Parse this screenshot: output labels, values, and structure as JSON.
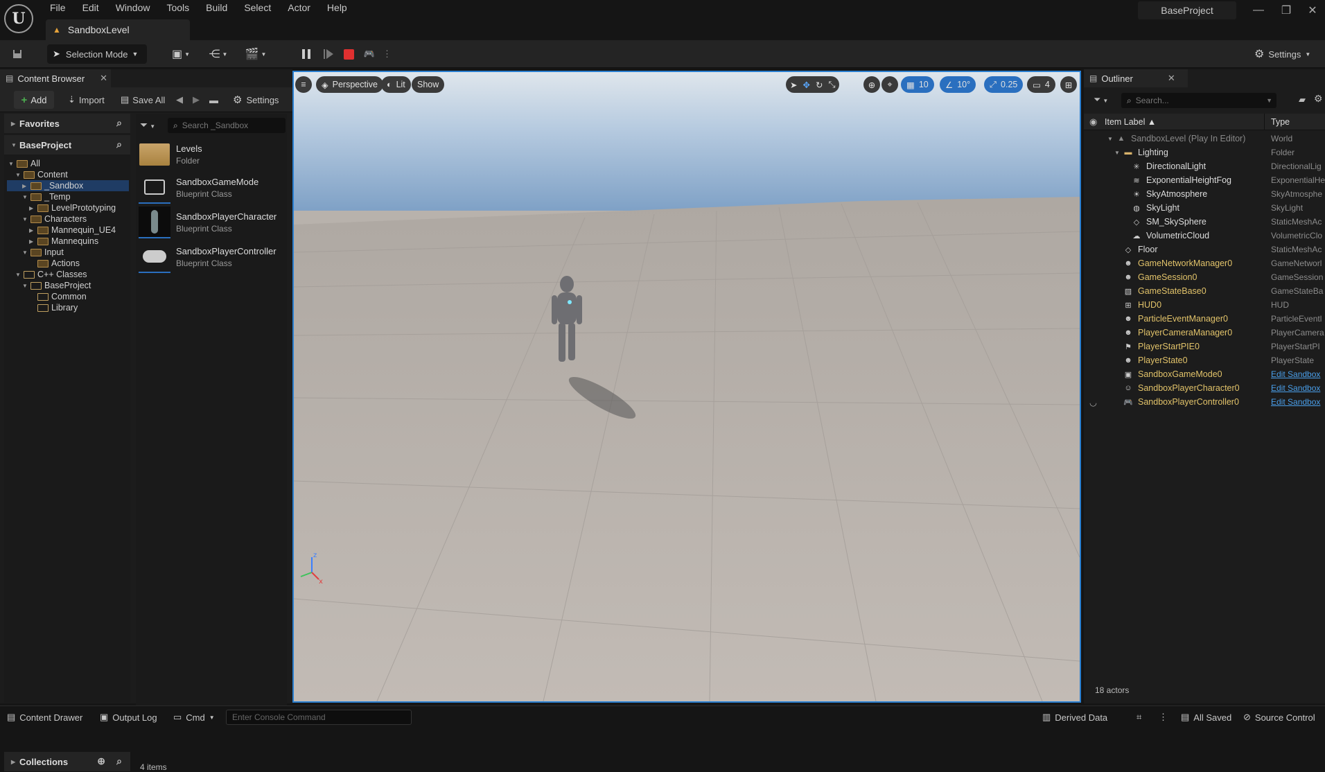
{
  "app": {
    "logo": "U",
    "project": "BaseProject"
  },
  "menu": [
    "File",
    "Edit",
    "Window",
    "Tools",
    "Build",
    "Select",
    "Actor",
    "Help"
  ],
  "level_tab": "SandboxLevel",
  "toolbar": {
    "selection_mode": "Selection Mode",
    "settings": "Settings"
  },
  "content_browser": {
    "tab": "Content Browser",
    "add": "Add",
    "import": "Import",
    "save_all": "Save All",
    "settings": "Settings",
    "favorites": "Favorites",
    "project": "BaseProject",
    "tree": [
      "All",
      "Content",
      "_Sandbox",
      "_Temp",
      "LevelPrototyping",
      "Characters",
      "Mannequin_UE4",
      "Mannequins",
      "Input",
      "Actions",
      "C++ Classes",
      "BaseProject",
      "Common",
      "Library"
    ],
    "search_placeholder": "Search _Sandbox",
    "assets": [
      {
        "name": "Levels",
        "type": "Folder"
      },
      {
        "name": "SandboxGameMode",
        "type": "Blueprint Class"
      },
      {
        "name": "SandboxPlayerCharacter",
        "type": "Blueprint Class"
      },
      {
        "name": "SandboxPlayerController",
        "type": "Blueprint Class"
      }
    ],
    "items_count": "4 items",
    "collections": "Collections"
  },
  "viewport": {
    "perspective": "Perspective",
    "lit": "Lit",
    "show": "Show",
    "grid": "10",
    "angle": "10°",
    "scale": "0.25",
    "camera_speed": "4"
  },
  "outliner": {
    "tab": "Outliner",
    "search_placeholder": "Search...",
    "col_label": "Item Label ▲",
    "col_type": "Type",
    "rows": [
      {
        "label": "SandboxLevel (Play In Editor)",
        "type": "World"
      },
      {
        "label": "Lighting",
        "type": "Folder"
      },
      {
        "label": "DirectionalLight",
        "type": "DirectionalLig"
      },
      {
        "label": "ExponentialHeightFog",
        "type": "ExponentialHe"
      },
      {
        "label": "SkyAtmosphere",
        "type": "SkyAtmosphe"
      },
      {
        "label": "SkyLight",
        "type": "SkyLight"
      },
      {
        "label": "SM_SkySphere",
        "type": "StaticMeshAc"
      },
      {
        "label": "VolumetricCloud",
        "type": "VolumetricClo"
      },
      {
        "label": "Floor",
        "type": "StaticMeshAc"
      },
      {
        "label": "GameNetworkManager0",
        "type": "GameNetworl"
      },
      {
        "label": "GameSession0",
        "type": "GameSession"
      },
      {
        "label": "GameStateBase0",
        "type": "GameStateBa"
      },
      {
        "label": "HUD0",
        "type": "HUD"
      },
      {
        "label": "ParticleEventManager0",
        "type": "ParticleEventl"
      },
      {
        "label": "PlayerCameraManager0",
        "type": "PlayerCamera"
      },
      {
        "label": "PlayerStartPIE0",
        "type": "PlayerStartPI"
      },
      {
        "label": "PlayerState0",
        "type": "PlayerState"
      },
      {
        "label": "SandboxGameMode0",
        "type": "Edit Sandbox"
      },
      {
        "label": "SandboxPlayerCharacter0",
        "type": "Edit Sandbox"
      },
      {
        "label": "SandboxPlayerController0",
        "type": "Edit Sandbox"
      }
    ],
    "actors": "18 actors"
  },
  "status": {
    "content_drawer": "Content Drawer",
    "output_log": "Output Log",
    "cmd": "Cmd",
    "console_placeholder": "Enter Console Command",
    "derived_data": "Derived Data",
    "all_saved": "All Saved",
    "source_control": "Source Control"
  }
}
